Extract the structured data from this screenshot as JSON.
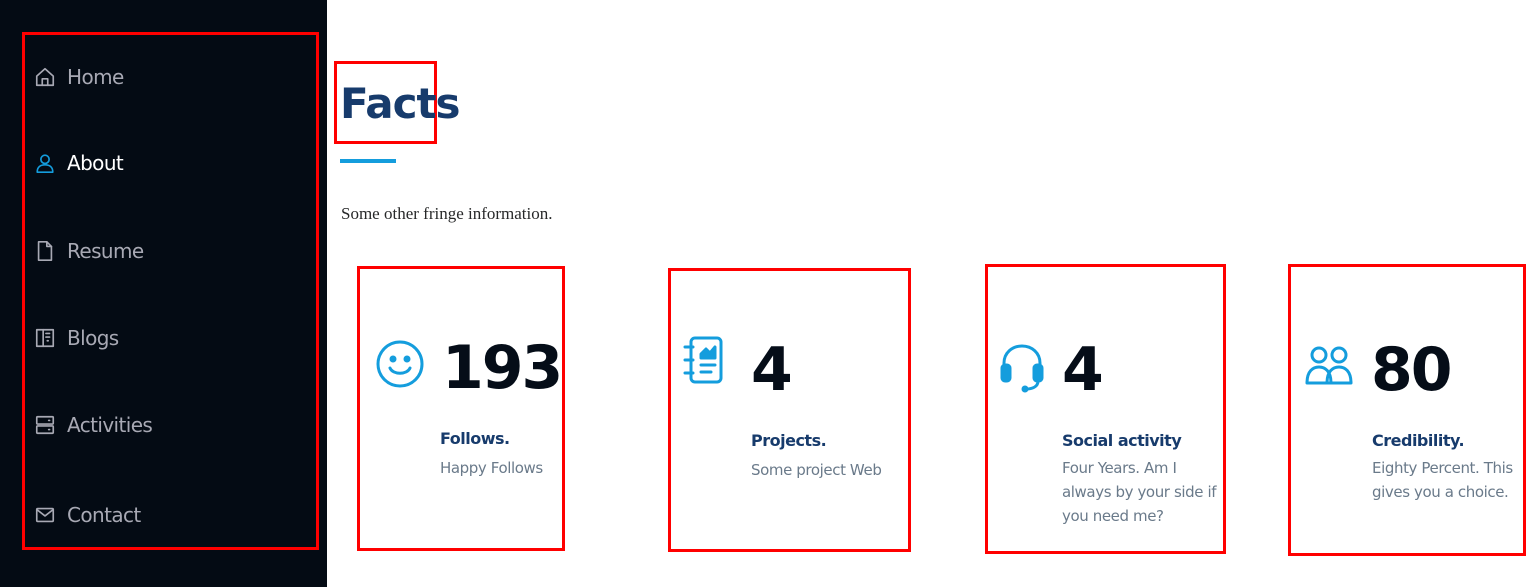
{
  "sidebar": {
    "items": [
      {
        "label": "Home",
        "icon": "house-icon",
        "active": false
      },
      {
        "label": "About",
        "icon": "person-icon",
        "active": true
      },
      {
        "label": "Resume",
        "icon": "file-icon",
        "active": false
      },
      {
        "label": "Blogs",
        "icon": "book-icon",
        "active": false
      },
      {
        "label": "Activities",
        "icon": "server-icon",
        "active": false
      },
      {
        "label": "Contact",
        "icon": "envelope-icon",
        "active": false
      }
    ]
  },
  "section": {
    "title": "Facts",
    "description": "Some other fringe information."
  },
  "facts": [
    {
      "icon": "smiley-icon",
      "count": "193",
      "label": "Follows.",
      "description": "Happy Follows"
    },
    {
      "icon": "journal-richtext-icon",
      "count": "4",
      "label": "Projects.",
      "description": "Some project Web"
    },
    {
      "icon": "headset-icon",
      "count": "4",
      "label": "Social activity",
      "description": "Four Years. Am I always by your side if you need me?"
    },
    {
      "icon": "people-icon",
      "count": "80",
      "label": "Credibility.",
      "description": "Eighty Percent. This gives you a choice."
    }
  ],
  "colors": {
    "sidebar_bg": "#040b14",
    "accent": "#149ddd",
    "title": "#173b6c",
    "highlight_border": "#ff0000"
  }
}
